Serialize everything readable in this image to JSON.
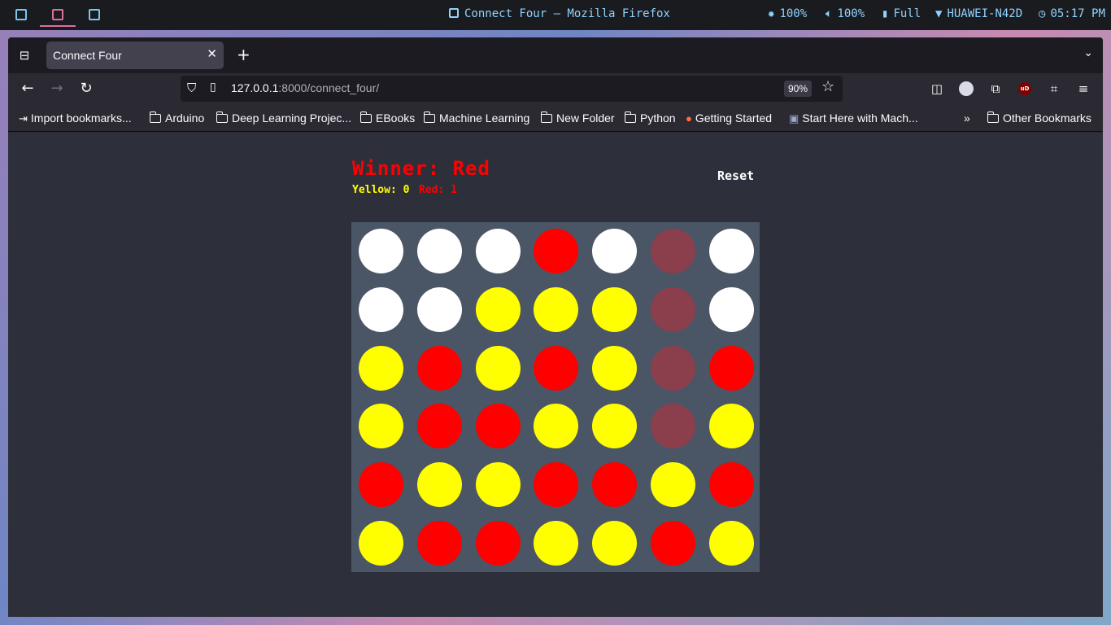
{
  "system_bar": {
    "window_title": "Connect Four — Mozilla Firefox",
    "brightness": "100%",
    "volume": "100%",
    "battery": "Full",
    "wifi": "HUAWEI-N42D",
    "time": "05:17 PM"
  },
  "browser": {
    "tab_title": "Connect Four",
    "url_host": "127.0.0.1",
    "url_rest": ":8000/connect_four/",
    "zoom": "90%",
    "bookmarks": [
      "Import bookmarks...",
      "Arduino",
      "Deep Learning Projec...",
      "EBooks",
      "Machine Learning",
      "New Folder",
      "Python",
      "Getting Started",
      "Start Here with Mach..."
    ],
    "other_bookmarks": "Other Bookmarks"
  },
  "game": {
    "winner_text": "Winner: Red",
    "yellow_score": "Yellow: 0",
    "red_score": "Red: 1",
    "reset_label": "Reset",
    "colors": {
      "red": "#ff0000",
      "yellow": "#ffff00",
      "empty": "#ffffff",
      "winning": "#8b3f4d",
      "board": "#4a5566"
    },
    "grid": [
      [
        "E",
        "E",
        "E",
        "R",
        "E",
        "W",
        "E"
      ],
      [
        "E",
        "E",
        "Y",
        "Y",
        "Y",
        "W",
        "E"
      ],
      [
        "Y",
        "R",
        "Y",
        "R",
        "Y",
        "W",
        "R"
      ],
      [
        "Y",
        "R",
        "R",
        "Y",
        "Y",
        "W",
        "Y"
      ],
      [
        "R",
        "Y",
        "Y",
        "R",
        "R",
        "Y",
        "R"
      ],
      [
        "Y",
        "R",
        "R",
        "Y",
        "Y",
        "R",
        "Y"
      ]
    ]
  }
}
